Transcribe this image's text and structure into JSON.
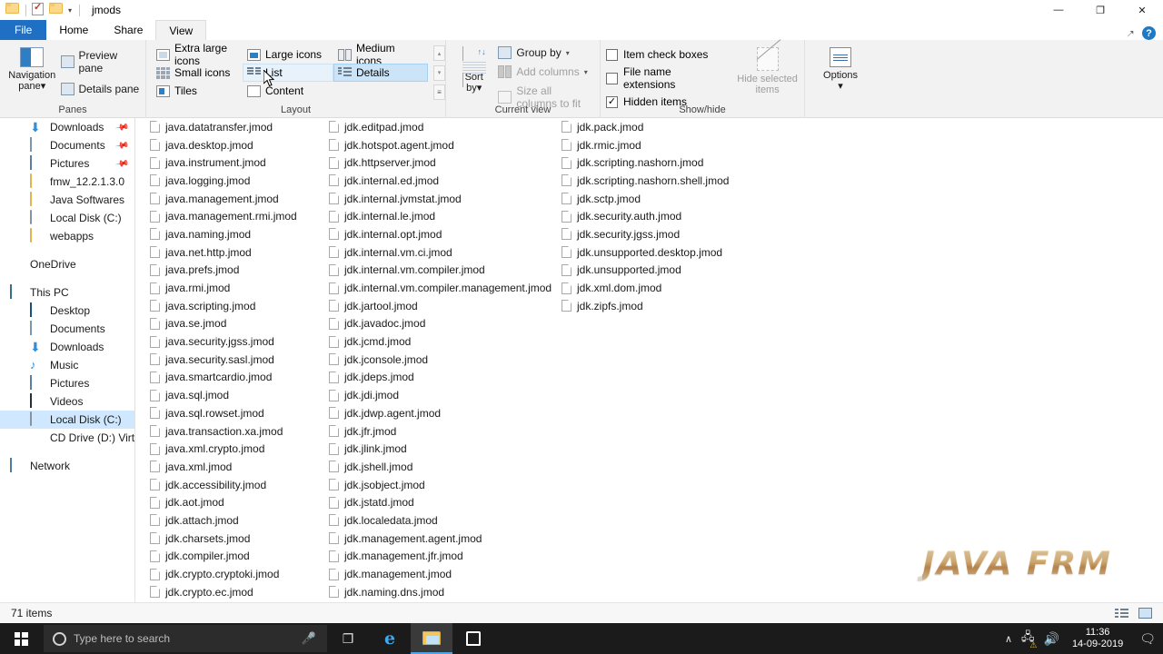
{
  "window": {
    "title": "jmods",
    "quick_access": [
      "folder-icon",
      "properties-icon",
      "dropdown-caret-icon"
    ],
    "controls": {
      "minimize": "—",
      "restore": "❐",
      "close": "✕"
    }
  },
  "tabs": [
    {
      "label": "File",
      "id": "file"
    },
    {
      "label": "Home",
      "id": "home"
    },
    {
      "label": "Share",
      "id": "share"
    },
    {
      "label": "View",
      "id": "view",
      "active": true
    }
  ],
  "tab_right": {
    "pin_label": "➖",
    "help_label": "?"
  },
  "ribbon": {
    "groups": [
      {
        "name": "panes",
        "label": "Panes",
        "big_button": {
          "label_line1": "Navigation",
          "label_line2": "pane",
          "caret": "▾"
        },
        "items": [
          {
            "label": "Preview pane",
            "disabled": false
          },
          {
            "label": "Details pane",
            "disabled": false
          }
        ]
      },
      {
        "name": "layout",
        "label": "Layout",
        "items": [
          {
            "label": "Extra large icons",
            "state": "normal"
          },
          {
            "label": "Large icons",
            "state": "normal"
          },
          {
            "label": "Medium icons",
            "state": "normal"
          },
          {
            "label": "Small icons",
            "state": "normal"
          },
          {
            "label": "List",
            "state": "hovered"
          },
          {
            "label": "Details",
            "state": "selected"
          },
          {
            "label": "Tiles",
            "state": "normal"
          },
          {
            "label": "Content",
            "state": "normal"
          }
        ],
        "scroll": {
          "up": "▴",
          "down": "▾",
          "more": "☰"
        }
      },
      {
        "name": "current-view",
        "label": "Current view",
        "big_button": {
          "label_line1": "Sort",
          "label_line2": "by",
          "caret": "▾"
        },
        "items": [
          {
            "label": "Group by",
            "caret": "▾",
            "disabled": false
          },
          {
            "label": "Add columns",
            "caret": "▾",
            "disabled": true
          },
          {
            "label": "Size all columns to fit",
            "disabled": true
          }
        ]
      },
      {
        "name": "show-hide",
        "label": "Show/hide",
        "checkboxes": [
          {
            "label": "Item check boxes",
            "checked": false
          },
          {
            "label": "File name extensions",
            "checked": false
          },
          {
            "label": "Hidden items",
            "checked": true
          }
        ],
        "big_button": {
          "label_line1": "Hide selected",
          "label_line2": "items",
          "disabled": true
        }
      },
      {
        "name": "options",
        "label": "",
        "big_button": {
          "label_line1": "Options",
          "label_line2": "▾"
        }
      }
    ]
  },
  "navigation_pane": {
    "items": [
      {
        "label": "Downloads",
        "icon": "download-icon",
        "indent": 2,
        "pinned": true
      },
      {
        "label": "Documents",
        "icon": "document-icon",
        "indent": 2,
        "pinned": true
      },
      {
        "label": "Pictures",
        "icon": "picture-icon",
        "indent": 2,
        "pinned": true
      },
      {
        "label": "fmw_12.2.1.3.0",
        "icon": "folder-icon",
        "indent": 2
      },
      {
        "label": "Java Softwares",
        "icon": "folder-icon",
        "indent": 2
      },
      {
        "label": "Local Disk (C:)",
        "icon": "disk-icon",
        "indent": 2
      },
      {
        "label": "webapps",
        "icon": "folder-icon",
        "indent": 2
      },
      {
        "gap": true
      },
      {
        "label": "OneDrive",
        "icon": "cloud-icon",
        "indent": 1
      },
      {
        "gap": true
      },
      {
        "label": "This PC",
        "icon": "pc-icon",
        "indent": 1
      },
      {
        "label": "Desktop",
        "icon": "desktop-icon",
        "indent": 2
      },
      {
        "label": "Documents",
        "icon": "document-icon",
        "indent": 2
      },
      {
        "label": "Downloads",
        "icon": "download-icon",
        "indent": 2
      },
      {
        "label": "Music",
        "icon": "music-icon",
        "indent": 2
      },
      {
        "label": "Pictures",
        "icon": "picture-icon",
        "indent": 2
      },
      {
        "label": "Videos",
        "icon": "video-icon",
        "indent": 2
      },
      {
        "label": "Local Disk (C:)",
        "icon": "disk-icon",
        "indent": 2,
        "selected": true
      },
      {
        "label": "CD Drive (D:) Virtua",
        "icon": "cd-icon",
        "indent": 2
      },
      {
        "gap": true
      },
      {
        "label": "Network",
        "icon": "network-icon",
        "indent": 1
      }
    ]
  },
  "file_list": {
    "columns": [
      {
        "width": "col-a",
        "files": [
          "java.datatransfer.jmod",
          "java.desktop.jmod",
          "java.instrument.jmod",
          "java.logging.jmod",
          "java.management.jmod",
          "java.management.rmi.jmod",
          "java.naming.jmod",
          "java.net.http.jmod",
          "java.prefs.jmod",
          "java.rmi.jmod",
          "java.scripting.jmod",
          "java.se.jmod",
          "java.security.jgss.jmod",
          "java.security.sasl.jmod",
          "java.smartcardio.jmod",
          "java.sql.jmod",
          "java.sql.rowset.jmod",
          "java.transaction.xa.jmod",
          "java.xml.crypto.jmod",
          "java.xml.jmod",
          "jdk.accessibility.jmod",
          "jdk.aot.jmod",
          "jdk.attach.jmod",
          "jdk.charsets.jmod",
          "jdk.compiler.jmod",
          "jdk.crypto.cryptoki.jmod",
          "jdk.crypto.ec.jmod"
        ]
      },
      {
        "width": "col-b",
        "files": [
          "jdk.editpad.jmod",
          "jdk.hotspot.agent.jmod",
          "jdk.httpserver.jmod",
          "jdk.internal.ed.jmod",
          "jdk.internal.jvmstat.jmod",
          "jdk.internal.le.jmod",
          "jdk.internal.opt.jmod",
          "jdk.internal.vm.ci.jmod",
          "jdk.internal.vm.compiler.jmod",
          "jdk.internal.vm.compiler.management.jmod",
          "jdk.jartool.jmod",
          "jdk.javadoc.jmod",
          "jdk.jcmd.jmod",
          "jdk.jconsole.jmod",
          "jdk.jdeps.jmod",
          "jdk.jdi.jmod",
          "jdk.jdwp.agent.jmod",
          "jdk.jfr.jmod",
          "jdk.jlink.jmod",
          "jdk.jshell.jmod",
          "jdk.jsobject.jmod",
          "jdk.jstatd.jmod",
          "jdk.localedata.jmod",
          "jdk.management.agent.jmod",
          "jdk.management.jfr.jmod",
          "jdk.management.jmod",
          "jdk.naming.dns.jmod"
        ]
      },
      {
        "width": "col-c",
        "files": [
          "jdk.pack.jmod",
          "jdk.rmic.jmod",
          "jdk.scripting.nashorn.jmod",
          "jdk.scripting.nashorn.shell.jmod",
          "jdk.sctp.jmod",
          "jdk.security.auth.jmod",
          "jdk.security.jgss.jmod",
          "jdk.unsupported.desktop.jmod",
          "jdk.unsupported.jmod",
          "jdk.xml.dom.jmod",
          "jdk.zipfs.jmod"
        ]
      }
    ]
  },
  "watermark": {
    "text": "JAVA FRM"
  },
  "status_bar": {
    "item_count": "71 items",
    "views": [
      {
        "name": "details-view",
        "label": "Details view"
      },
      {
        "name": "large-icons-view",
        "label": "Large icons view"
      }
    ]
  },
  "taskbar": {
    "start": "start-icon",
    "search_placeholder": "Type here to search",
    "mic": "microphone-icon",
    "buttons": [
      {
        "name": "task-view-icon",
        "glyph": "❐"
      },
      {
        "name": "edge-icon",
        "glyph": "e"
      },
      {
        "name": "file-explorer-icon",
        "glyph": "",
        "active": true
      },
      {
        "name": "microsoft-store-icon",
        "glyph": ""
      }
    ],
    "tray": {
      "chevron": "∧",
      "network": "network-icon",
      "volume": "ᵒ))",
      "time": "11:36",
      "date": "14-09-2019",
      "notifications": "❐"
    }
  },
  "colors": {
    "accent": "#1f6fc4",
    "selection": "#cce4f7",
    "nav_selection": "#cfe8ff",
    "ribbon_bg": "#f2f2f2",
    "taskbar_bg": "#1b1b1b"
  }
}
